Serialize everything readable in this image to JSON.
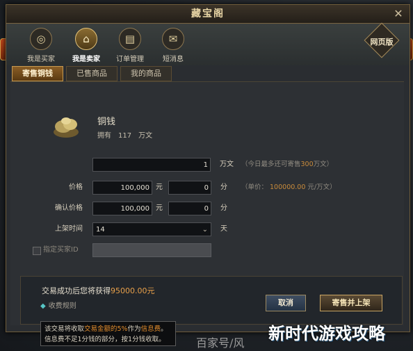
{
  "window": {
    "title": "藏宝阁",
    "close_glyph": "✕"
  },
  "nav": [
    {
      "label": "我是买家",
      "icon": "coin-icon",
      "glyph": "◎"
    },
    {
      "label": "我是卖家",
      "icon": "pavilion-icon",
      "glyph": "⌂"
    },
    {
      "label": "订单管理",
      "icon": "book-icon",
      "glyph": "▤"
    },
    {
      "label": "短消息",
      "icon": "envelope-icon",
      "glyph": "✉"
    }
  ],
  "web_button": {
    "label": "网页版"
  },
  "tabs": [
    {
      "label": "寄售铜钱"
    },
    {
      "label": "已售商品"
    },
    {
      "label": "我的商品"
    }
  ],
  "item": {
    "name": "铜钱",
    "own_label": "拥有",
    "own_value": "117",
    "own_unit": "万文"
  },
  "form": {
    "amount_value": "1",
    "amount_unit": "万文",
    "amount_note_prefix": "（今日最多还可寄售",
    "amount_note_value": "300",
    "amount_note_suffix": "万文）",
    "price_label": "价格",
    "price_value": "100,000",
    "yuan": "元",
    "price_fen_value": "0",
    "fen": "分",
    "unit_price_label": "（单价：",
    "unit_price_value": "100000.00",
    "unit_price_unit": "元/万文）",
    "confirm_label": "确认价格",
    "confirm_value": "100,000",
    "confirm_fen_value": "0",
    "time_label": "上架时间",
    "time_value": "14",
    "time_unit": "天",
    "buyer_label": "指定买家ID"
  },
  "summary": {
    "gain_prefix": "交易成功后您将获得",
    "gain_value": "95000.00元",
    "rules_label": "收费规则"
  },
  "buttons": {
    "cancel": "取消",
    "sell": "寄售并上架"
  },
  "tooltip": {
    "line1_prefix": "该交易将收取",
    "line1_highlight": "交易金额的5%",
    "line1_mid": "作为",
    "line1_highlight2": "信息费",
    "line1_suffix": "。",
    "line2": "信息费不足1分钱的部分，按1分钱收取。"
  },
  "watermark": {
    "main": "新时代游戏攻略",
    "sub": "百家号/风"
  }
}
